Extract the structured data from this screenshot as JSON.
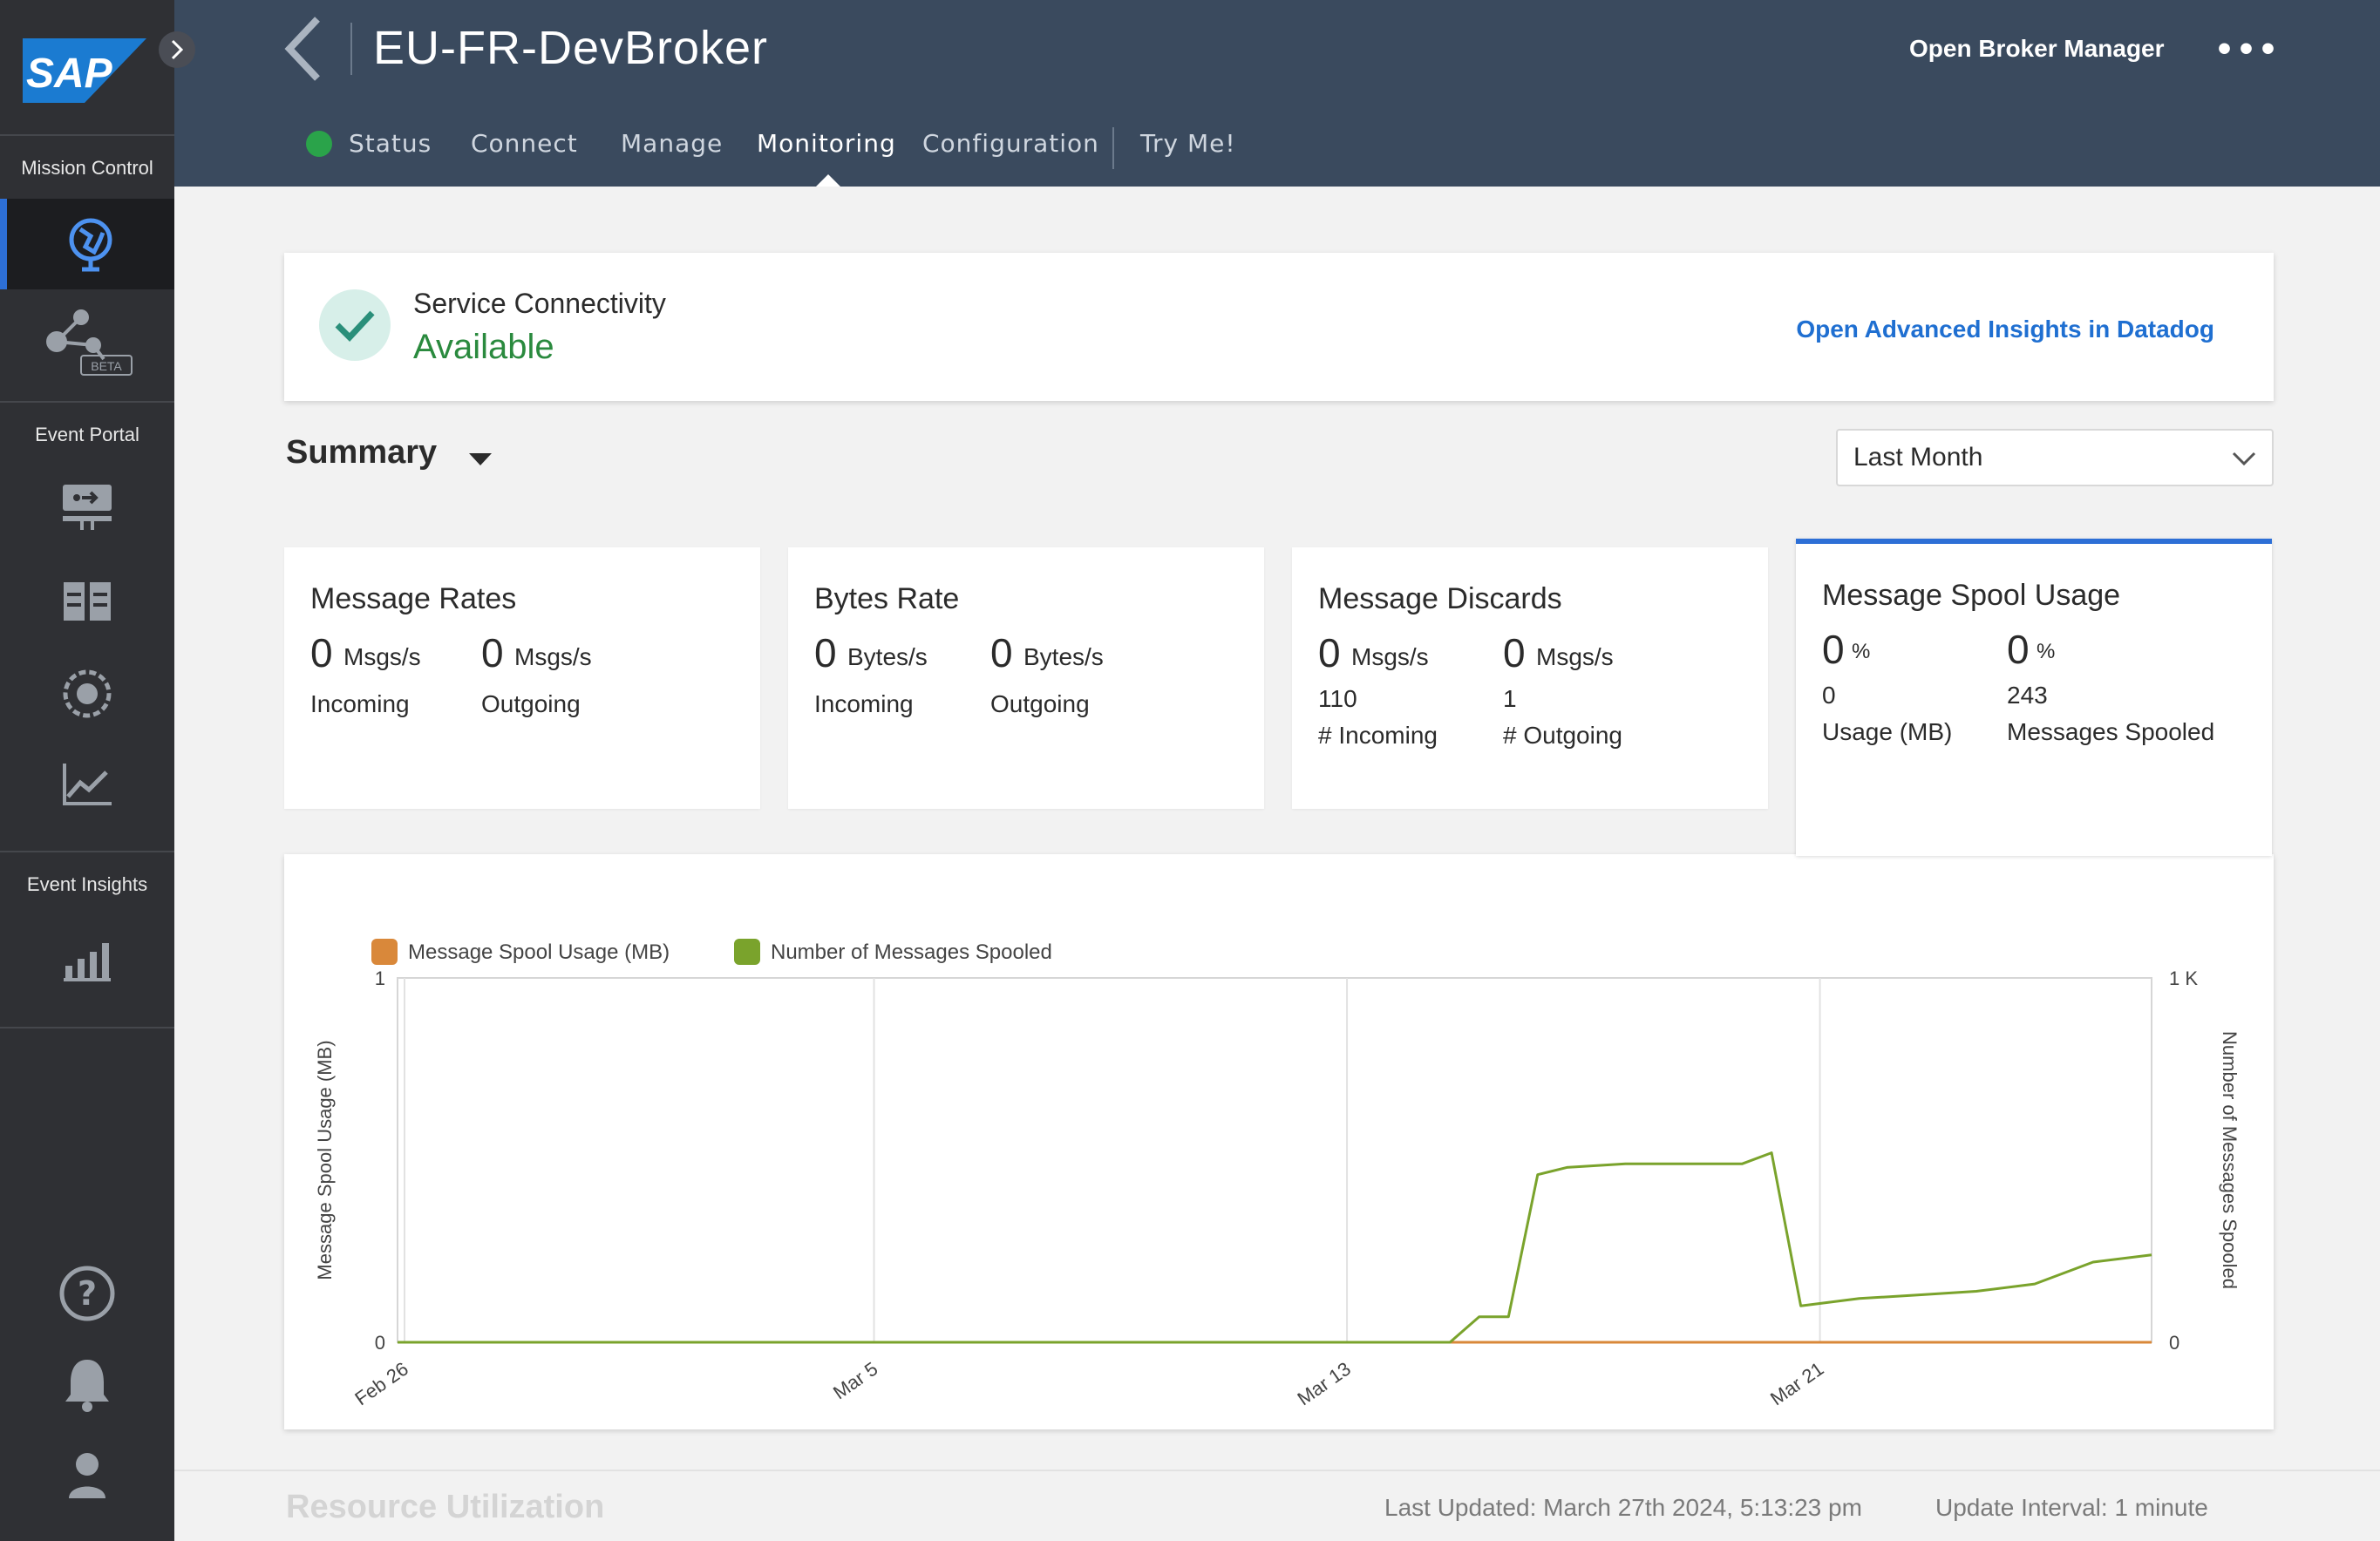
{
  "app": {
    "logo_text": "SAP",
    "broker_name": "EU-FR-DevBroker",
    "open_broker_manager": "Open Broker Manager",
    "more_menu": "•••"
  },
  "sidebar": {
    "mission_control_label": "Mission Control",
    "event_portal_label": "Event Portal",
    "event_insights_label": "Event Insights",
    "beta_badge": "BETA"
  },
  "tabs": [
    {
      "label": "Status"
    },
    {
      "label": "Connect"
    },
    {
      "label": "Manage"
    },
    {
      "label": "Monitoring"
    },
    {
      "label": "Configuration"
    },
    {
      "label": "Try Me!"
    }
  ],
  "connectivity": {
    "label": "Service Connectivity",
    "status": "Available",
    "datadog_link": "Open Advanced Insights in Datadog"
  },
  "summary": {
    "title": "Summary",
    "range": "Last Month"
  },
  "metrics": {
    "message_rates": {
      "title": "Message Rates",
      "incoming_value": "0",
      "incoming_unit": "Msgs/s",
      "incoming_label": "Incoming",
      "outgoing_value": "0",
      "outgoing_unit": "Msgs/s",
      "outgoing_label": "Outgoing"
    },
    "bytes_rate": {
      "title": "Bytes Rate",
      "incoming_value": "0",
      "incoming_unit": "Bytes/s",
      "incoming_label": "Incoming",
      "outgoing_value": "0",
      "outgoing_unit": "Bytes/s",
      "outgoing_label": "Outgoing"
    },
    "message_discards": {
      "title": "Message Discards",
      "incoming_value": "0",
      "incoming_unit": "Msgs/s",
      "incoming_count": "110",
      "incoming_label": "# Incoming",
      "outgoing_value": "0",
      "outgoing_unit": "Msgs/s",
      "outgoing_count": "1",
      "outgoing_label": "# Outgoing"
    },
    "spool_usage": {
      "title": "Message Spool Usage",
      "usage_value": "0",
      "usage_unit": "%",
      "usage_mb": "0",
      "usage_label": "Usage (MB)",
      "spooled_value": "0",
      "spooled_unit": "%",
      "spooled_count": "243",
      "spooled_label": "Messages Spooled"
    }
  },
  "chart_data": {
    "type": "line",
    "x_tick_labels": [
      "Feb 26",
      "Mar 5",
      "Mar 13",
      "Mar 21"
    ],
    "y_left_label": "Message Spool Usage (MB)",
    "y_left_ticks": [
      "1",
      "0"
    ],
    "y_left_range": [
      0,
      1
    ],
    "y_right_label": "Number of Messages Spooled",
    "y_right_ticks": [
      "1 K",
      "0"
    ],
    "y_right_range": [
      0,
      1000
    ],
    "xlim": [
      "2024-02-26",
      "2024-03-27"
    ],
    "legend_position": "top-left",
    "grid": true,
    "series": [
      {
        "name": "Message Spool Usage (MB)",
        "axis": "left",
        "color": "#d9883a",
        "x": [
          "2024-02-28",
          "2024-03-27"
        ],
        "values": [
          0,
          0
        ]
      },
      {
        "name": "Number of Messages Spooled",
        "axis": "right",
        "color": "#7aa32c",
        "x": [
          "2024-02-26",
          "2024-03-15",
          "2024-03-15T12:00",
          "2024-03-16",
          "2024-03-16T12:00",
          "2024-03-17",
          "2024-03-18",
          "2024-03-20",
          "2024-03-20T12:00",
          "2024-03-21",
          "2024-03-21T12:00",
          "2024-03-22",
          "2024-03-23",
          "2024-03-24",
          "2024-03-25",
          "2024-03-26",
          "2024-03-27"
        ],
        "values": [
          0,
          0,
          70,
          70,
          460,
          480,
          490,
          490,
          520,
          100,
          110,
          120,
          130,
          140,
          160,
          220,
          240
        ]
      }
    ]
  },
  "footer": {
    "section_title": "Resource Utilization",
    "last_updated": "Last Updated: March 27th 2024, 5:13:23 pm",
    "update_interval": "Update Interval: 1 minute"
  }
}
